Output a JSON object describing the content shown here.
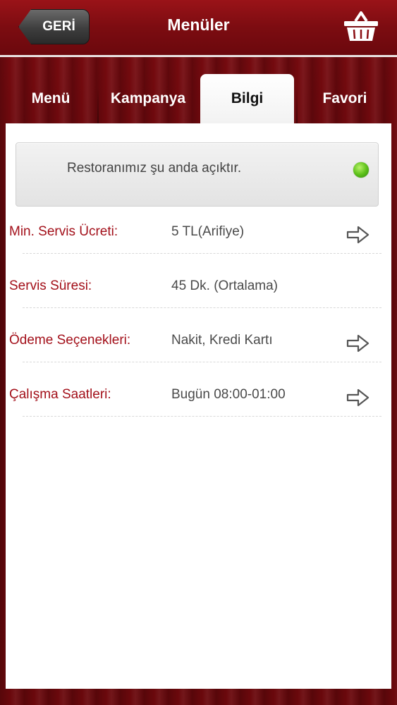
{
  "header": {
    "back_label": "GERİ",
    "title": "Menüler",
    "basket_icon": "basket-icon"
  },
  "tabs": [
    {
      "label": "Menü",
      "active": false
    },
    {
      "label": "Kampanya",
      "active": false
    },
    {
      "label": "Bilgi",
      "active": true
    },
    {
      "label": "Favori",
      "active": false
    }
  ],
  "status": {
    "text": "Restoranımız şu anda açıktır.",
    "indicator_color": "#5fc21b"
  },
  "info_rows": [
    {
      "label": "Min. Servis Ücreti:",
      "value": "5 TL(Arifiye)",
      "has_arrow": true
    },
    {
      "label": "Servis Süresi:",
      "value": "45 Dk. (Ortalama)",
      "has_arrow": false
    },
    {
      "label": "Ödeme Seçenekleri:",
      "value": "Nakit, Kredi Kartı",
      "has_arrow": true
    },
    {
      "label": "Çalışma Saatleri:",
      "value": "Bugün 08:00-01:00",
      "has_arrow": true
    }
  ],
  "colors": {
    "brand_red": "#7c0c11",
    "label_red": "#a3101a"
  }
}
